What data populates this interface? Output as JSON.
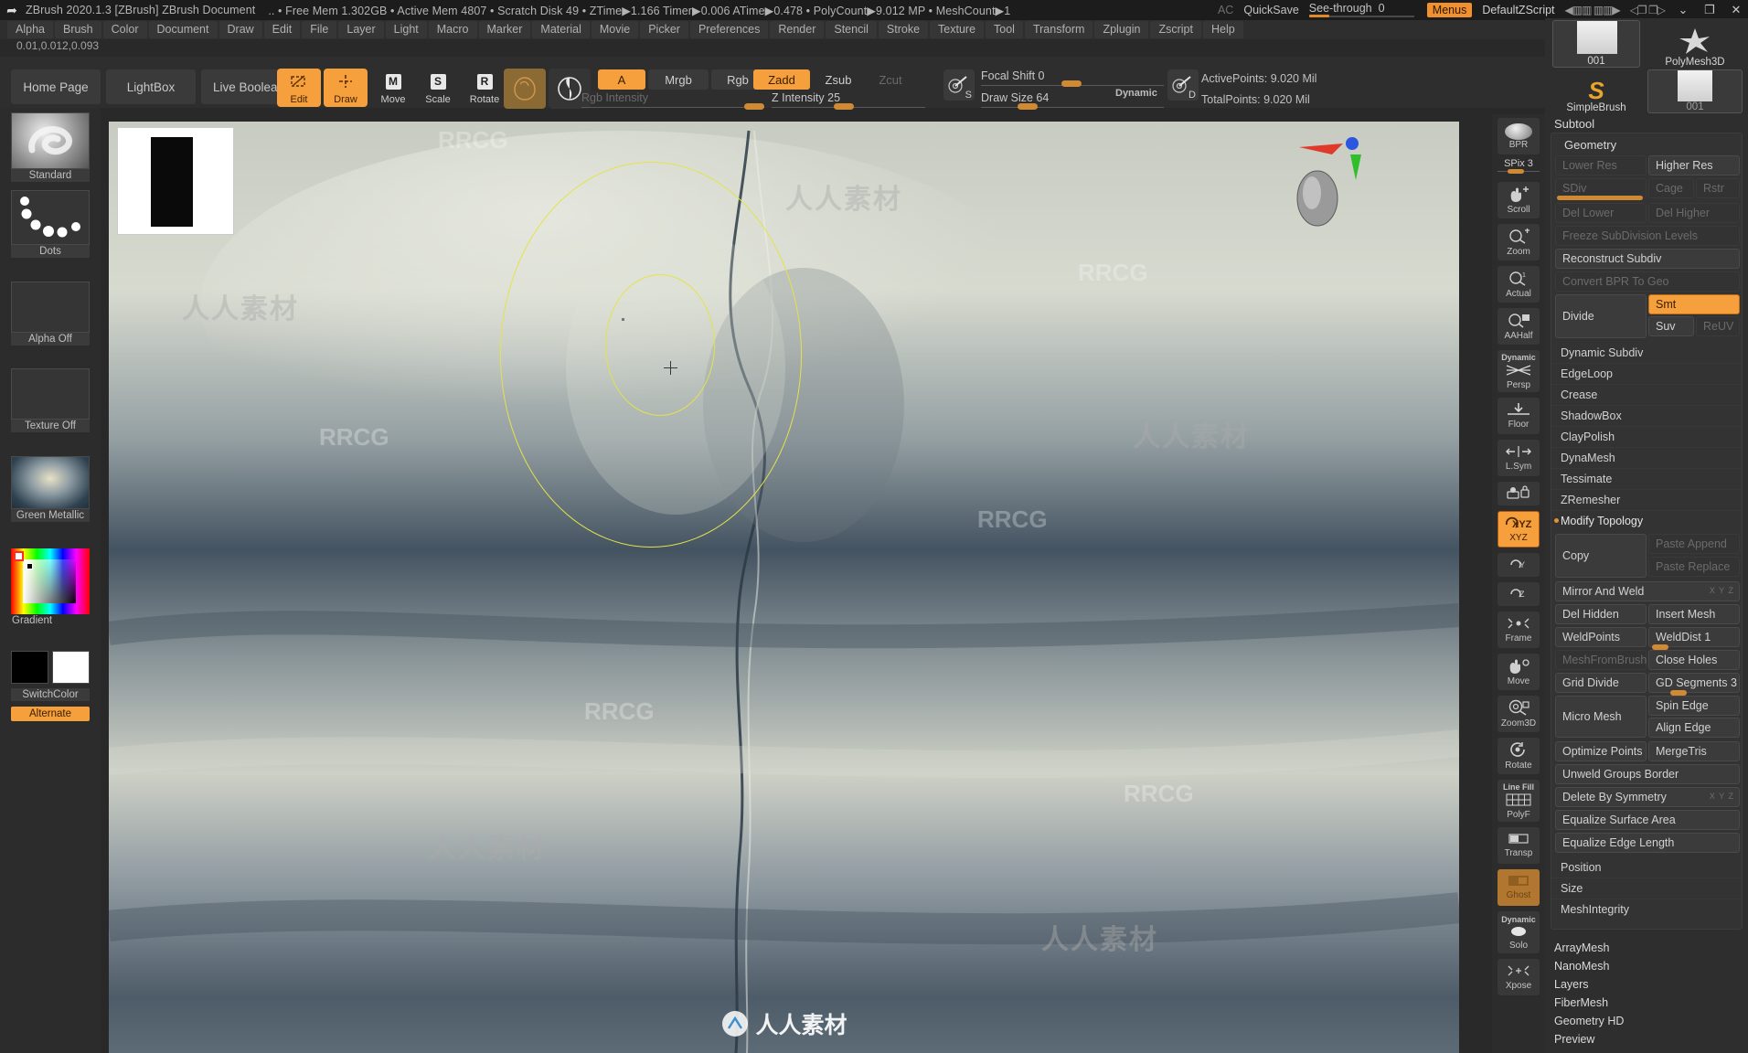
{
  "titlebar": {
    "app_title": "ZBrush 2020.1.3 [ZBrush]   ZBrush Document",
    "stats": ".. • Free Mem 1.302GB • Active Mem 4807 • Scratch Disk 49 • ZTime▶1.166 Timer▶0.006 ATime▶0.478 • PolyCount▶9.012 MP • MeshCount▶1",
    "ac": "AC",
    "quicksave": "QuickSave",
    "seethrough_label": "See-through",
    "seethrough_value": "0",
    "menus": "Menus",
    "zscript": "DefaultZScript",
    "minimize": "⌄",
    "maximize": "❐",
    "close": "✕"
  },
  "menubar": {
    "items": [
      "Alpha",
      "Brush",
      "Color",
      "Document",
      "Draw",
      "Edit",
      "File",
      "Layer",
      "Light",
      "Macro",
      "Marker",
      "Material",
      "Movie",
      "Picker",
      "Preferences",
      "Render",
      "Stencil",
      "Stroke",
      "Texture",
      "Tool",
      "Transform",
      "Zplugin",
      "Zscript",
      "Help"
    ]
  },
  "coords": "0.01,0.012,0.093",
  "toolbar": {
    "home_page": "Home Page",
    "lightbox": "LightBox",
    "live_boolean": "Live Boolean",
    "edit": "Edit",
    "draw": "Draw",
    "move": "Move",
    "move_key": "M",
    "scale": "Scale",
    "scale_key": "S",
    "rotate": "Rotate",
    "rotate_key": "R",
    "alpha_a": "A",
    "mrgb": "Mrgb",
    "rgb": "Rgb",
    "m": "M",
    "zadd": "Zadd",
    "zsub": "Zsub",
    "zcut": "Zcut",
    "rgb_intensity_label": "Rgb Intensity",
    "z_intensity_label": "Z Intensity 25",
    "focal_shift_label": "Focal Shift 0",
    "draw_size_label": "Draw Size 64",
    "dynamic_label": "Dynamic",
    "s_badge": "S",
    "d_badge": "D",
    "active_points": "ActivePoints: 9.020 Mil",
    "total_points": "TotalPoints: 9.020 Mil"
  },
  "left_shelf": [
    {
      "name": "brush",
      "caption": "Standard"
    },
    {
      "name": "stroke",
      "caption": "Dots"
    },
    {
      "name": "alpha",
      "caption": "Alpha Off"
    },
    {
      "name": "texture",
      "caption": "Texture Off"
    },
    {
      "name": "material",
      "caption": "Green Metallic"
    },
    {
      "name": "color-picker",
      "caption": "Gradient"
    },
    {
      "name": "switch-color",
      "caption": "SwitchColor"
    },
    {
      "name": "alternate",
      "caption": "Alternate"
    }
  ],
  "canvas": {
    "watermarks": [
      "RRCG",
      "RRCG",
      "RRCG",
      "RRCG",
      "RRCG",
      "RRCG"
    ],
    "cn_watermarks": [
      "人人素材",
      "人人素材",
      "人人素材",
      "人人素材",
      "人人素材"
    ],
    "bottom_logo": "人人素材"
  },
  "rail": {
    "bpr": "BPR",
    "spix_label": "SPix 3",
    "items": [
      {
        "label": "Scroll",
        "icon": "hand-scroll-icon",
        "state": "off"
      },
      {
        "label": "Zoom",
        "icon": "magnifier-zoom-icon",
        "state": "off"
      },
      {
        "label": "Actual",
        "icon": "magnifier-actual-icon",
        "state": "off"
      },
      {
        "label": "AAHalf",
        "icon": "magnifier-aahalf-icon",
        "state": "off"
      },
      {
        "label": "Persp",
        "icon": "perspective-icon",
        "state": "off",
        "sublabel": "Dynamic"
      },
      {
        "label": "Floor",
        "icon": "floor-grid-icon",
        "state": "off"
      },
      {
        "label": "L.Sym",
        "icon": "local-symmetry-icon",
        "state": "off"
      },
      {
        "label": "",
        "icon": "lock-transform-icon",
        "state": "off"
      },
      {
        "label": "XYZ",
        "icon": "xyz-rotate-icon",
        "state": "on"
      },
      {
        "label": "",
        "icon": "y-rotate-icon",
        "state": "off"
      },
      {
        "label": "",
        "icon": "z-rotate-icon",
        "state": "off"
      },
      {
        "label": "Frame",
        "icon": "frame-icon",
        "state": "off"
      },
      {
        "label": "Move",
        "icon": "move-hand-icon",
        "state": "off"
      },
      {
        "label": "Zoom3D",
        "icon": "zoom3d-icon",
        "state": "off"
      },
      {
        "label": "Rotate",
        "icon": "rotate-icon",
        "state": "off"
      },
      {
        "label": "PolyF",
        "icon": "polyframe-icon",
        "state": "off",
        "sublabel": "Line Fill"
      },
      {
        "label": "Transp",
        "icon": "transparency-icon",
        "state": "off"
      },
      {
        "label": "Ghost",
        "icon": "ghost-icon",
        "state": "ghost"
      },
      {
        "label": "Solo",
        "icon": "solo-icon",
        "state": "off",
        "sublabel": "Dynamic"
      },
      {
        "label": "Xpose",
        "icon": "xpose-icon",
        "state": "off"
      }
    ]
  },
  "right_panel": {
    "tool_thumb_1": "001",
    "polymesh": "PolyMesh3D",
    "simplebrush": "SimpleBrush",
    "tool_thumb_2": "001",
    "subtool": "Subtool",
    "geometry": "Geometry",
    "lower_res": "Lower Res",
    "higher_res": "Higher Res",
    "sdiv_label": "SDiv",
    "cage": "Cage",
    "rstr": "Rstr",
    "del_lower": "Del Lower",
    "del_higher": "Del Higher",
    "freeze_subdiv": "Freeze SubDivision Levels",
    "reconstruct_subdiv": "Reconstruct Subdiv",
    "convert_bpr": "Convert BPR To Geo",
    "divide": "Divide",
    "smt": "Smt",
    "suv": "Suv",
    "reuv": "ReUV",
    "sections": [
      "Dynamic Subdiv",
      "EdgeLoop",
      "Crease",
      "ShadowBox",
      "ClayPolish",
      "DynaMesh",
      "Tessimate",
      "ZRemesher"
    ],
    "modify_topology": "Modify Topology",
    "copy": "Copy",
    "paste_append": "Paste Append",
    "paste_replace": "Paste Replace",
    "mirror_and_weld": "Mirror And Weld",
    "del_hidden": "Del Hidden",
    "insert_mesh": "Insert Mesh",
    "weld_points": "WeldPoints",
    "weld_dist": "WeldDist 1",
    "mesh_from_brush": "MeshFromBrush",
    "close_holes": "Close Holes",
    "grid_divide": "Grid Divide",
    "gd_segments": "GD Segments 3",
    "micro_mesh": "Micro Mesh",
    "spin_edge": "Spin Edge",
    "align_edge": "Align Edge",
    "optimize_points": "Optimize Points",
    "merge_tris": "MergeTris",
    "unweld_groups_border": "Unweld Groups Border",
    "delete_by_symmetry": "Delete By Symmetry",
    "equalize_surface_area": "Equalize Surface Area",
    "equalize_edge_length": "Equalize Edge Length",
    "position": "Position",
    "size": "Size",
    "mesh_integrity": "MeshIntegrity",
    "bottom_sections": [
      "ArrayMesh",
      "NanoMesh",
      "Layers",
      "FiberMesh",
      "Geometry HD",
      "Preview"
    ],
    "xyz_mini": "X Y Z"
  }
}
